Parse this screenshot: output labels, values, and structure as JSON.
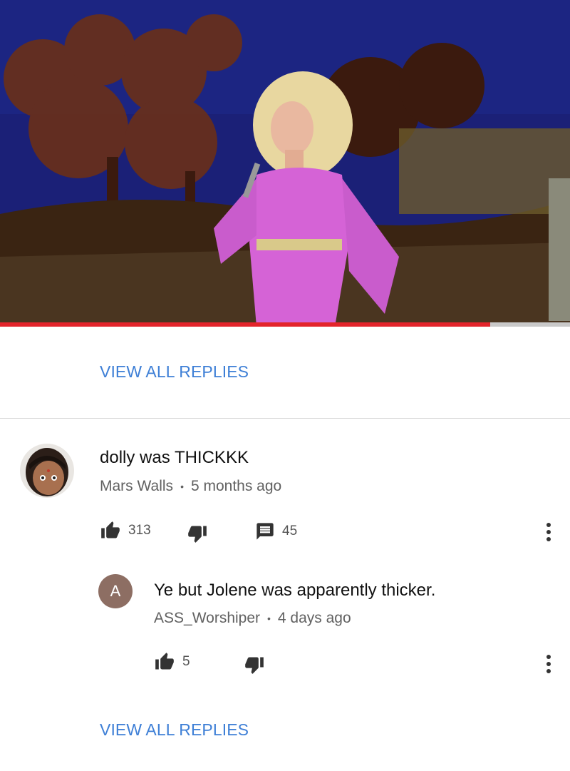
{
  "video": {
    "progress_percent": 86
  },
  "top_link": "VIEW ALL REPLIES",
  "comment": {
    "text": "dolly was THICKKK",
    "author": "Mars Walls",
    "time": "5 months ago",
    "likes": "313",
    "replies": "45",
    "avatar_icon": "user-photo"
  },
  "reply": {
    "avatar_letter": "A",
    "avatar_color": "#8d6e63",
    "text": "Ye but Jolene was apparently thicker.",
    "author": "ASS_Worshiper",
    "time": "4 days ago",
    "likes": "5"
  },
  "bottom_link": "VIEW ALL REPLIES",
  "colors": {
    "link": "#3e7fd6",
    "progress": "#e3242b"
  },
  "separator": "•"
}
